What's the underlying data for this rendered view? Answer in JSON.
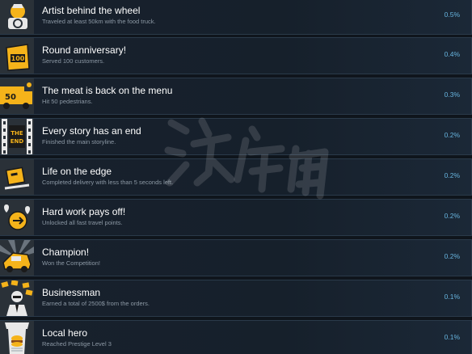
{
  "achievements": [
    {
      "title": "Artist behind the wheel",
      "description": "Traveled at least 50km with the food truck.",
      "percent": "0.5%",
      "icon": "artist-wheel-icon"
    },
    {
      "title": "Round anniversary!",
      "description": "Served 100 customers.",
      "percent": "0.4%",
      "icon": "hundred-bag-icon",
      "icon_text": "100"
    },
    {
      "title": "The meat is back on the menu",
      "description": "Hit 50 pedestrians.",
      "percent": "0.3%",
      "icon": "truck-fifty-icon",
      "icon_text": "50"
    },
    {
      "title": "Every story has an end",
      "description": "Finished the main storyline.",
      "percent": "0.2%",
      "icon": "the-end-film-icon",
      "icon_text_1": "THE",
      "icon_text_2": "END"
    },
    {
      "title": "Life on the edge",
      "description": "Completed delivery with less than 5 seconds left.",
      "percent": "0.2%",
      "icon": "delivery-box-icon"
    },
    {
      "title": "Hard work pays off!",
      "description": "Unlocked all fast travel points.",
      "percent": "0.2%",
      "icon": "travel-points-icon"
    },
    {
      "title": "Champion!",
      "description": "Won the Competition!",
      "percent": "0.2%",
      "icon": "champion-truck-icon"
    },
    {
      "title": "Businessman",
      "description": "Earned a total of 2500$ from the orders.",
      "percent": "0.1%",
      "icon": "businessman-icon"
    },
    {
      "title": "Local hero",
      "description": "Reached Prestige Level 3",
      "percent": "0.1%",
      "icon": "local-hero-icon"
    }
  ],
  "colors": {
    "accent": "#f5b31a",
    "percent": "#67b4de",
    "background": "#0f151c"
  }
}
